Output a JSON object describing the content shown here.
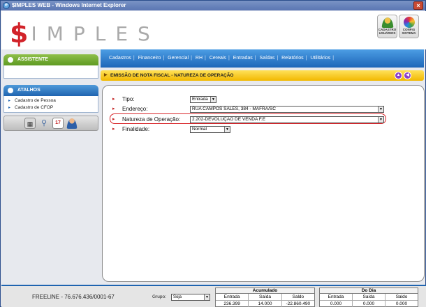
{
  "window": {
    "title": "$IMPLES WEB - Windows Internet Explorer"
  },
  "header": {
    "logo_dollar": "$",
    "logo_rest": "IMPLES",
    "buttons": [
      {
        "label_line1": "CADASTRO",
        "label_line2": "USUÁRIOS",
        "icon": "user-icon"
      },
      {
        "label_line1": "CONFIG",
        "label_line2": "SISTEMA",
        "icon": "color-wheel-icon"
      }
    ]
  },
  "sidebar": {
    "assistente_title": "ASSISTENTE",
    "atalhos_title": "ATALHOS",
    "shortcuts": [
      "Cadastro de Pessoa",
      "Cadastro de CFOP"
    ],
    "tools": [
      "calculator-icon",
      "search-icon",
      "calendar-icon",
      "user-icon"
    ],
    "calendar_day": "17"
  },
  "menu": {
    "items": [
      "Cadastros",
      "Financeiro",
      "Gerencial",
      "RH",
      "Cereais",
      "Entradas",
      "Saídas",
      "Relatórios",
      "Utilitários"
    ]
  },
  "section": {
    "title": "EMISSÃO DE NOTA FISCAL - NATUREZA DE OPERAÇÃO"
  },
  "form": {
    "tipo": {
      "label": "Tipo:",
      "value": "Entrada"
    },
    "endereco": {
      "label": "Endereço:",
      "value": "RUA CAMPOS SALES, 384 - MAFRA/SC"
    },
    "natureza": {
      "label": "Natureza de Operação:",
      "value": "2.202-DEVOLUÇÃO DE VENDA F.E"
    },
    "finalidade": {
      "label": "Finalidade:",
      "value": "Normal"
    }
  },
  "status": {
    "freeline": "FREELINE - 76.676.436/0001-67",
    "grupo_label": "Grupo:",
    "grupo_value": "Soja",
    "acumulado": {
      "title": "Acumulado",
      "cols": [
        "Entrada",
        "Saída",
        "Saldo"
      ],
      "values": [
        "236.399",
        "14.000",
        "-22.860.490"
      ]
    },
    "do_dia": {
      "title": "Do Dia",
      "cols": [
        "Entrada",
        "Saída",
        "Saldo"
      ],
      "values": [
        "0.000",
        "0.000",
        "0.000"
      ]
    }
  },
  "colors": {
    "menu_blue": "#1d66b8",
    "section_yellow": "#f2b800",
    "highlight_red": "#d8262b",
    "logo_red": "#d2232a"
  }
}
